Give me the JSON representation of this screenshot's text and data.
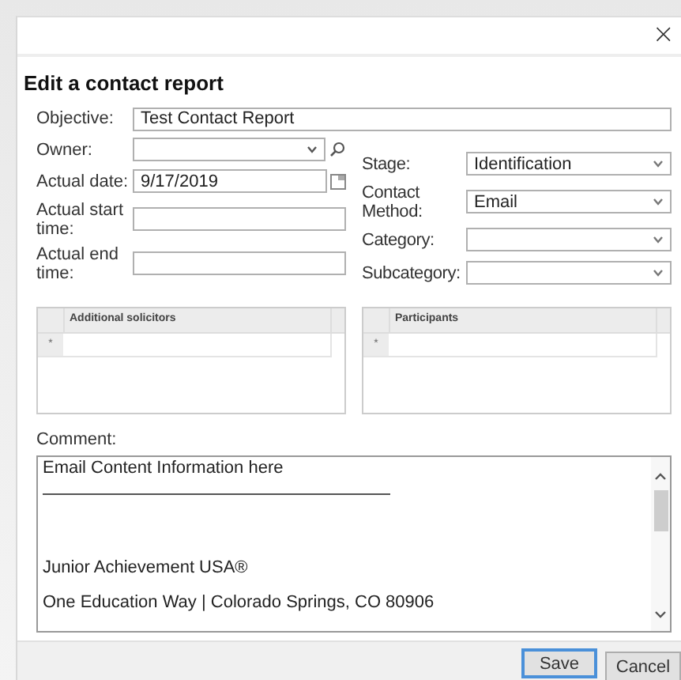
{
  "dialog": {
    "close": "×",
    "heading": "Edit a contact report"
  },
  "objective": {
    "label": "Objective:",
    "value": "Test Contact Report"
  },
  "left_fields": [
    {
      "label": "Owner:",
      "kind": "lookup"
    },
    {
      "label": "Actual date:",
      "kind": "date",
      "value": "9/17/2019"
    },
    {
      "label": "Actual start time:",
      "kind": "text"
    },
    {
      "label": "Actual end time:",
      "kind": "text"
    }
  ],
  "right_fields": [
    {
      "label": "Stage:",
      "kind": "select",
      "value": "Identification"
    },
    {
      "label": "Contact Method:",
      "kind": "select",
      "value": "Email"
    },
    {
      "label": "Category:",
      "kind": "select"
    },
    {
      "label": "Subcategory:",
      "kind": "select"
    }
  ],
  "grids": [
    {
      "column": "Additional solicitors",
      "new_row_marker": "*"
    },
    {
      "column": "Participants",
      "new_row_marker": "*"
    }
  ],
  "comment": {
    "label": "Comment:",
    "lines": [
      {
        "kind": "text",
        "text": "Email Content Information here"
      },
      {
        "kind": "rule"
      },
      {
        "kind": "gap"
      },
      {
        "kind": "text",
        "text": "Junior Achievement USA®"
      },
      {
        "kind": "text",
        "text": "One Education Way | Colorado Springs, CO 80906"
      }
    ]
  },
  "buttons": [
    {
      "label": "Save",
      "focused": true
    },
    {
      "label": "Cancel",
      "focused": false
    }
  ]
}
